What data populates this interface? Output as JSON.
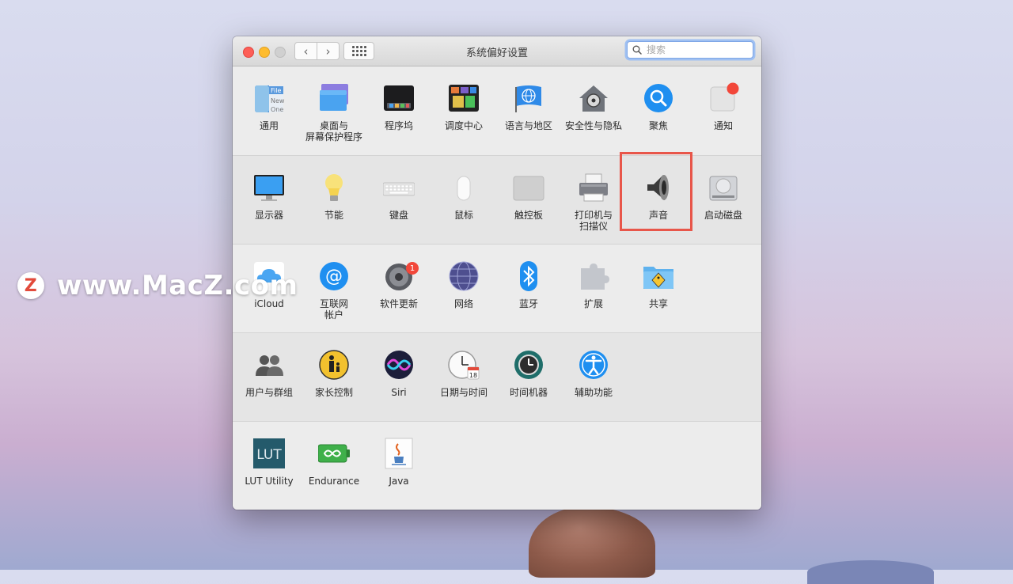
{
  "watermark": {
    "logo_letter": "Z",
    "text": "www.MacZ.com"
  },
  "window": {
    "title": "系统偏好设置",
    "nav": {
      "back_glyph": "‹",
      "forward_glyph": "›"
    },
    "search": {
      "placeholder": "搜索"
    }
  },
  "rows": [
    {
      "items": [
        {
          "label": "通用",
          "icon": "general-icon"
        },
        {
          "label": "桌面与\n屏幕保护程序",
          "icon": "desktop-icon"
        },
        {
          "label": "程序坞",
          "icon": "dock-icon"
        },
        {
          "label": "调度中心",
          "icon": "mission-control-icon"
        },
        {
          "label": "语言与地区",
          "icon": "language-region-icon"
        },
        {
          "label": "安全性与隐私",
          "icon": "security-icon"
        },
        {
          "label": "聚焦",
          "icon": "spotlight-icon"
        },
        {
          "label": "通知",
          "icon": "notifications-icon"
        }
      ]
    },
    {
      "items": [
        {
          "label": "显示器",
          "icon": "display-icon"
        },
        {
          "label": "节能",
          "icon": "energy-saver-icon"
        },
        {
          "label": "键盘",
          "icon": "keyboard-icon"
        },
        {
          "label": "鼠标",
          "icon": "mouse-icon"
        },
        {
          "label": "触控板",
          "icon": "trackpad-icon"
        },
        {
          "label": "打印机与\n扫描仪",
          "icon": "printer-icon"
        },
        {
          "label": "声音",
          "icon": "sound-icon"
        },
        {
          "label": "启动磁盘",
          "icon": "startup-disk-icon"
        }
      ]
    },
    {
      "items": [
        {
          "label": "iCloud",
          "icon": "icloud-icon"
        },
        {
          "label": "互联网\n帐户",
          "icon": "internet-accounts-icon"
        },
        {
          "label": "软件更新",
          "icon": "software-update-icon",
          "badge": "1"
        },
        {
          "label": "网络",
          "icon": "network-icon"
        },
        {
          "label": "蓝牙",
          "icon": "bluetooth-icon"
        },
        {
          "label": "扩展",
          "icon": "extensions-icon"
        },
        {
          "label": "共享",
          "icon": "sharing-icon"
        }
      ]
    },
    {
      "items": [
        {
          "label": "用户与群组",
          "icon": "users-groups-icon"
        },
        {
          "label": "家长控制",
          "icon": "parental-controls-icon"
        },
        {
          "label": "Siri",
          "icon": "siri-icon"
        },
        {
          "label": "日期与时间",
          "icon": "date-time-icon"
        },
        {
          "label": "时间机器",
          "icon": "time-machine-icon"
        },
        {
          "label": "辅助功能",
          "icon": "accessibility-icon"
        }
      ]
    },
    {
      "items": [
        {
          "label": "LUT Utility",
          "icon": "lut-utility-icon"
        },
        {
          "label": "Endurance",
          "icon": "endurance-icon"
        },
        {
          "label": "Java",
          "icon": "java-icon"
        }
      ]
    }
  ],
  "icon_text": {
    "general": {
      "line1": "File",
      "line2": "New",
      "line3": "One"
    },
    "lut": "LUT",
    "calendar_day": "18",
    "calendar_month": "JUL"
  },
  "highlighted_item": "声音",
  "colors": {
    "highlight": "#e8564a",
    "badge": "#f2473a",
    "search_focus": "#9fc0f2"
  }
}
